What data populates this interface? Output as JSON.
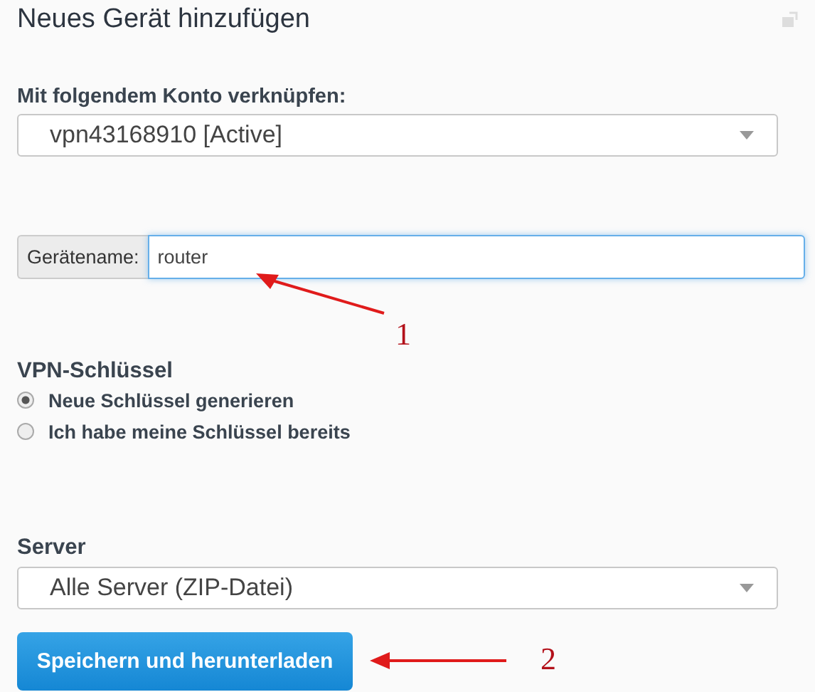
{
  "title": "Neues Gerät hinzufügen",
  "account": {
    "label": "Mit folgendem Konto verknüpfen:",
    "value": "vpn43168910 [Active]"
  },
  "device_name": {
    "label": "Gerätename:",
    "value": "router",
    "focused": true
  },
  "vpn_keys": {
    "heading": "VPN-Schlüssel",
    "options": [
      {
        "label": "Neue Schlüssel generieren",
        "selected": true
      },
      {
        "label": "Ich habe meine Schlüssel bereits",
        "selected": false
      }
    ]
  },
  "server": {
    "label": "Server",
    "value": "Alle Server (ZIP-Datei)"
  },
  "submit_button": "Speichern und herunterladen",
  "annotations": [
    {
      "number": "1"
    },
    {
      "number": "2"
    }
  ]
}
